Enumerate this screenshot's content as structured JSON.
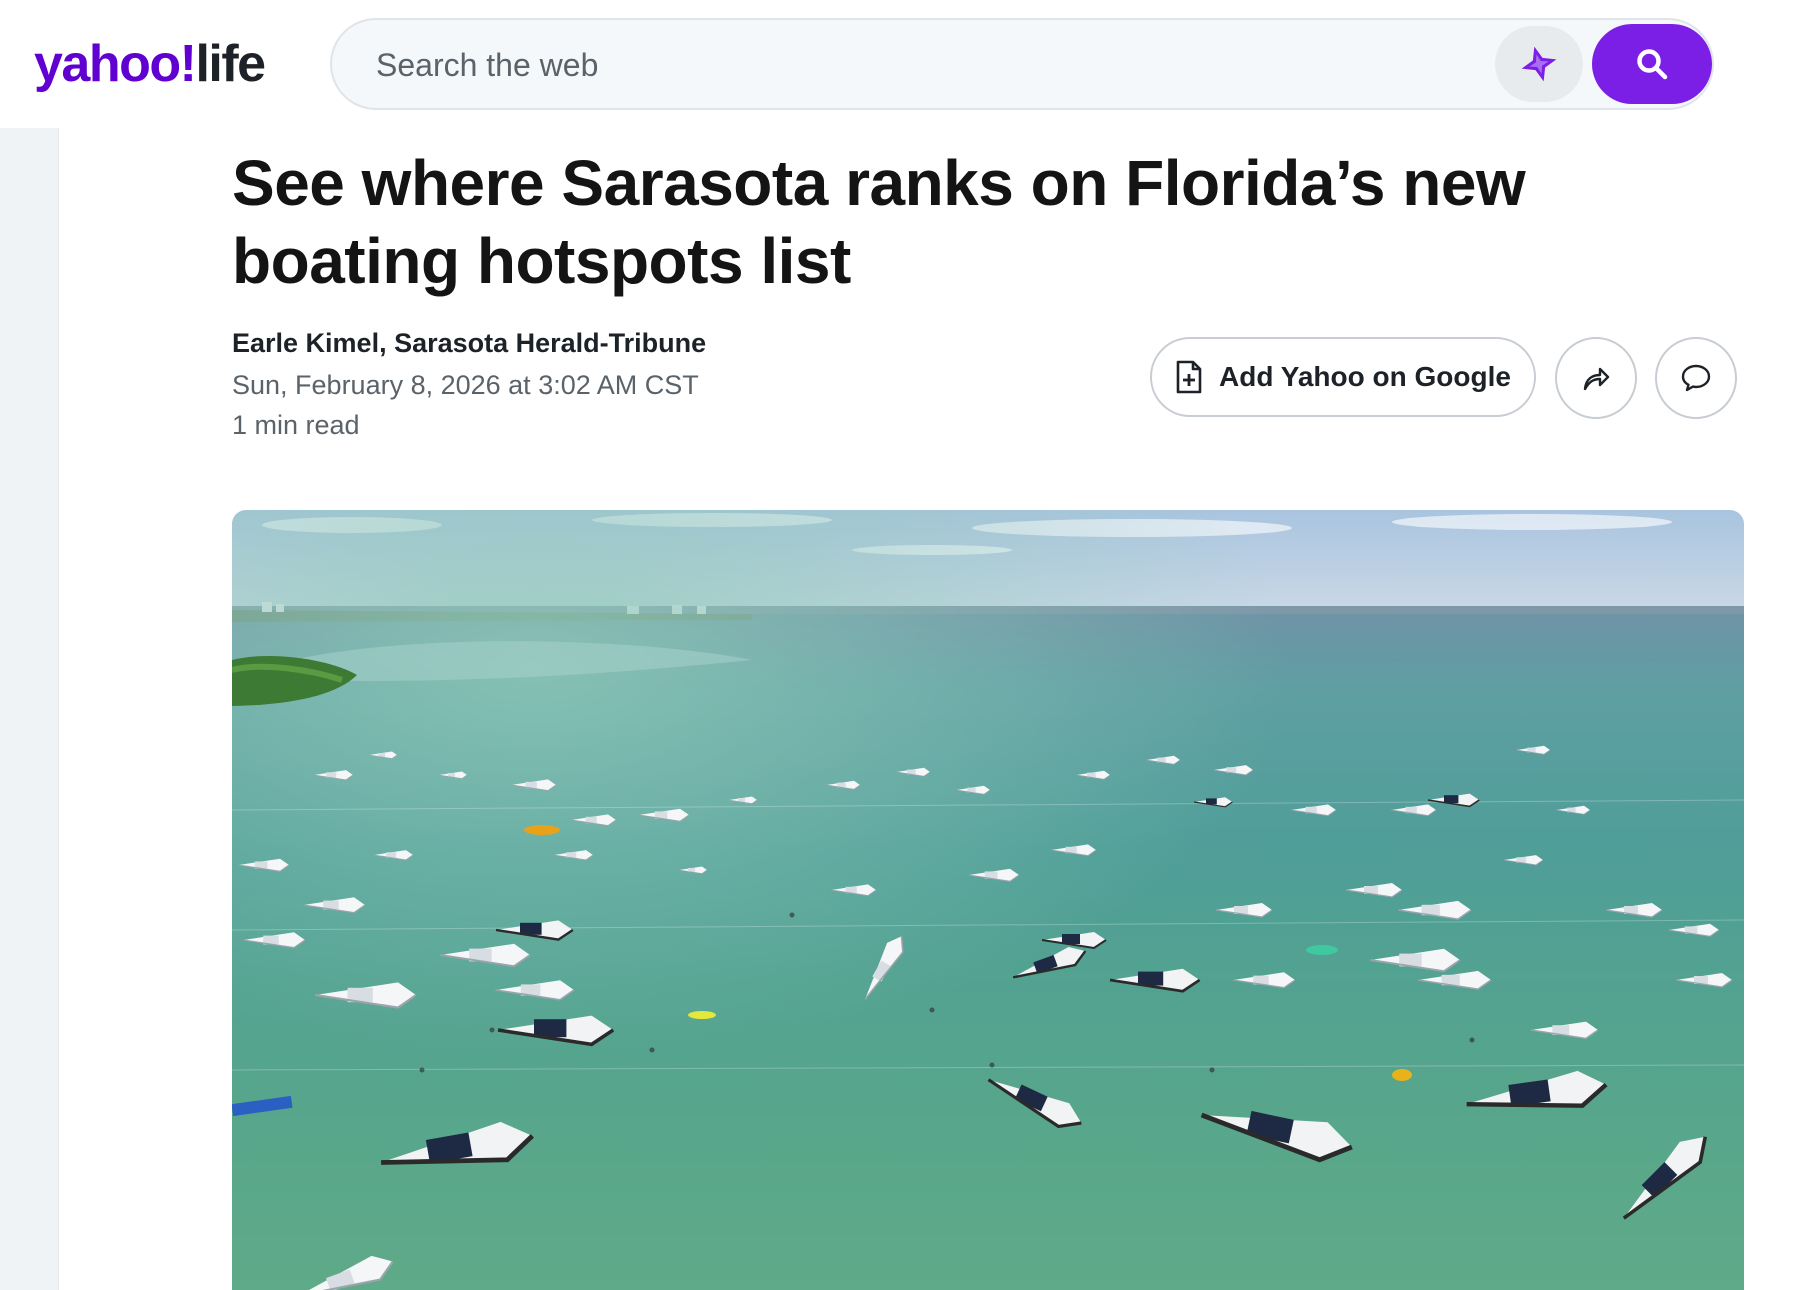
{
  "header": {
    "logo_brand": "yahoo!",
    "logo_section": "life",
    "search_placeholder": "Search the web",
    "icons": {
      "ai": "sparkle-star-icon",
      "search": "magnifier-icon"
    },
    "accent_color": "#7b1fe6",
    "brand_color": "#6001d2"
  },
  "article": {
    "headline": "See where Sarasota ranks on Florida’s new boating hotspots list",
    "author": "Earle Kimel, Sarasota Herald-Tribune",
    "date": "Sun, February 8, 2026 at 3:02 AM CST",
    "read_time": "1 min read",
    "actions": {
      "add_google_label": "Add Yahoo on Google",
      "icons": {
        "add_google": "document-plus-icon",
        "share": "share-arrow-icon",
        "comments": "comment-bubble-icon"
      }
    }
  },
  "hero_image": {
    "subject": "aerial-boats-sandbar-photo"
  }
}
